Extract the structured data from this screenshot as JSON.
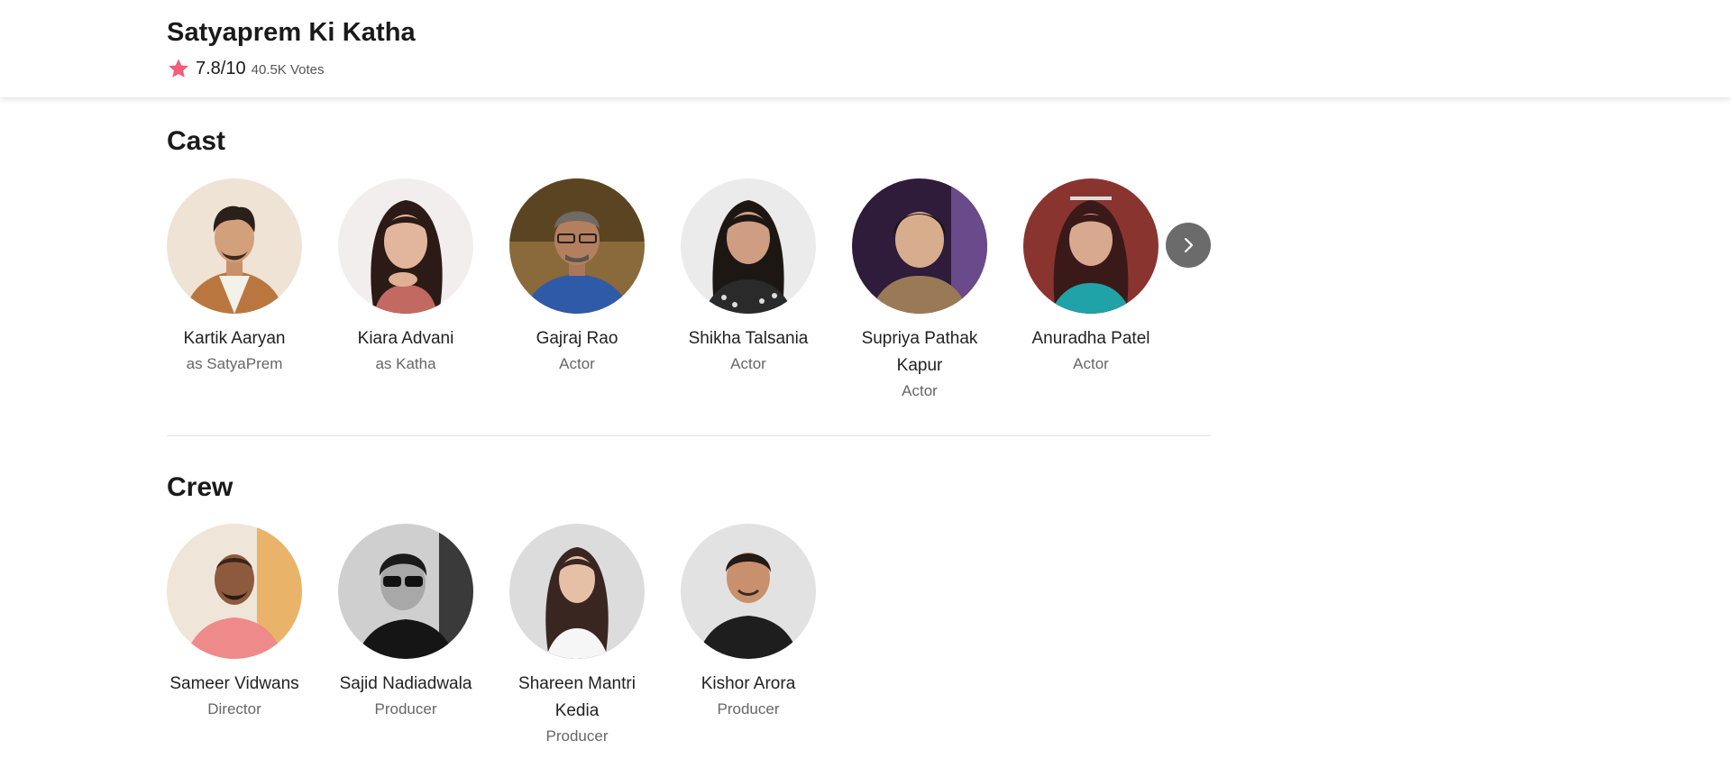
{
  "movie": {
    "title": "Satyaprem Ki Katha",
    "rating": "7.8/10",
    "votes": "40.5K Votes",
    "star_color": "#f25d7a"
  },
  "cast": {
    "heading": "Cast",
    "members": [
      {
        "name": "Kartik Aaryan",
        "role": "as SatyaPrem"
      },
      {
        "name": "Kiara Advani",
        "role": "as Katha"
      },
      {
        "name": "Gajraj Rao",
        "role": "Actor"
      },
      {
        "name": "Shikha Talsania",
        "role": "Actor"
      },
      {
        "name": "Supriya Pathak Kapur",
        "role": "Actor"
      },
      {
        "name": "Anuradha Patel",
        "role": "Actor"
      }
    ],
    "next_icon": "chevron-right-icon"
  },
  "crew": {
    "heading": "Crew",
    "members": [
      {
        "name": "Sameer Vidwans",
        "role": "Director"
      },
      {
        "name": "Sajid Nadiadwala",
        "role": "Producer"
      },
      {
        "name": "Shareen Mantri Kedia",
        "role": "Producer"
      },
      {
        "name": "Kishor Arora",
        "role": "Producer"
      }
    ]
  }
}
